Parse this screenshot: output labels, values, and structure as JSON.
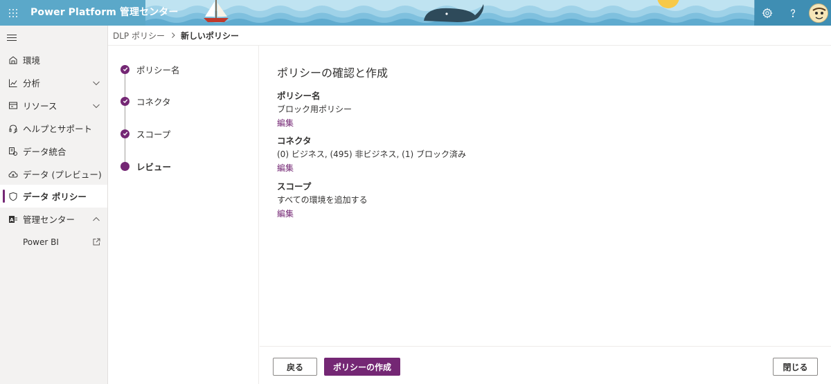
{
  "header": {
    "title": "Power Platform 管理センター",
    "icons": {
      "launcher": "waffle-icon",
      "settings": "gear-icon",
      "help": "question-icon",
      "avatar": "user-avatar"
    }
  },
  "sidebar": {
    "items": [
      {
        "label": "環境",
        "icon": "environment-icon"
      },
      {
        "label": "分析",
        "icon": "analytics-icon",
        "chevron": "down"
      },
      {
        "label": "リソース",
        "icon": "resources-icon",
        "chevron": "down"
      },
      {
        "label": "ヘルプとサポート",
        "icon": "headset-icon"
      },
      {
        "label": "データ統合",
        "icon": "data-integration-icon"
      },
      {
        "label": "データ (プレビュー)",
        "icon": "cloud-icon"
      },
      {
        "label": "データ ポリシー",
        "icon": "shield-icon",
        "active": true
      },
      {
        "label": "管理センター",
        "icon": "admin-icon",
        "chevron": "up"
      },
      {
        "label": "Power BI",
        "icon": "external-link-icon",
        "sub": true
      }
    ]
  },
  "breadcrumb": {
    "parent": "DLP ポリシー",
    "current": "新しいポリシー"
  },
  "steps": [
    {
      "label": "ポリシー名",
      "state": "done"
    },
    {
      "label": "コネクタ",
      "state": "done"
    },
    {
      "label": "スコープ",
      "state": "done"
    },
    {
      "label": "レビュー",
      "state": "current"
    }
  ],
  "main": {
    "title": "ポリシーの確認と作成",
    "sections": [
      {
        "heading": "ポリシー名",
        "value": "ブロック用ポリシー",
        "edit": "編集"
      },
      {
        "heading": "コネクタ",
        "value": "(0) ビジネス, (495) 非ビジネス, (1) ブロック済み",
        "edit": "編集"
      },
      {
        "heading": "スコープ",
        "value": "すべての環境を追加する",
        "edit": "編集"
      }
    ]
  },
  "footer": {
    "back_label": "戻る",
    "create_label": "ポリシーの作成",
    "close_label": "閉じる"
  },
  "colors": {
    "accent": "#742774",
    "header_bg": "#5ba8c9",
    "sidebar_bg": "#f3f2f1"
  }
}
